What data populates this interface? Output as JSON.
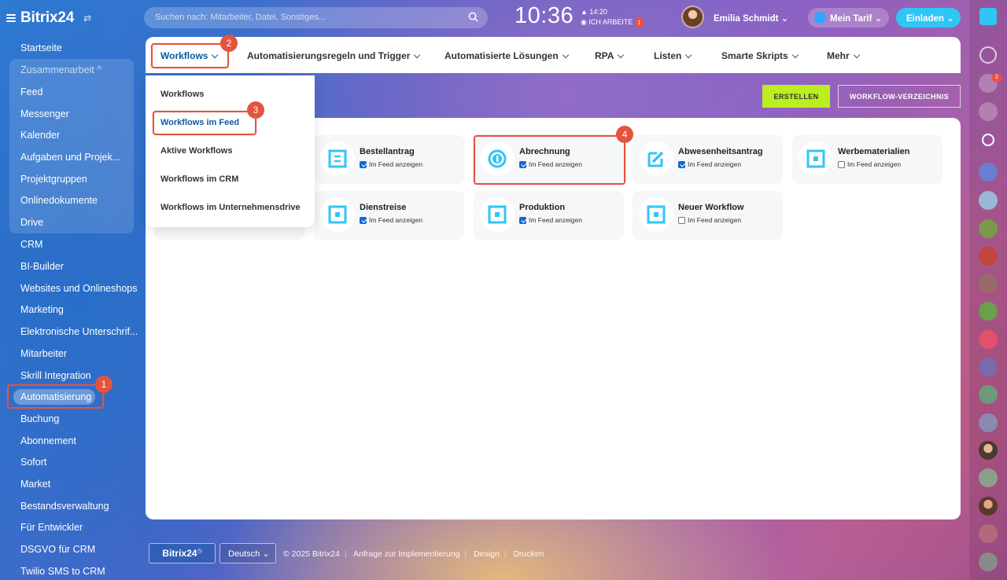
{
  "app": {
    "logo": "Bitrix24",
    "footer_logo": "Bitrix24"
  },
  "sidebar": {
    "items": [
      {
        "label": "Startseite"
      },
      {
        "label": "Zusammenarbeit ^"
      },
      {
        "label": "Feed"
      },
      {
        "label": "Messenger"
      },
      {
        "label": "Kalender"
      },
      {
        "label": "Aufgaben und Projek..."
      },
      {
        "label": "Projektgruppen"
      },
      {
        "label": "Onlinedokumente"
      },
      {
        "label": "Drive"
      },
      {
        "label": "CRM"
      },
      {
        "label": "BI-Builder"
      },
      {
        "label": "Websites und Onlineshops"
      },
      {
        "label": "Marketing"
      },
      {
        "label": "Elektronische Unterschrif..."
      },
      {
        "label": "Mitarbeiter"
      },
      {
        "label": "Skrill Integration"
      },
      {
        "label": "Automatisierung"
      },
      {
        "label": "Buchung"
      },
      {
        "label": "Abonnement"
      },
      {
        "label": "Sofort"
      },
      {
        "label": "Market"
      },
      {
        "label": "Bestandsverwaltung"
      },
      {
        "label": "Für Entwickler"
      },
      {
        "label": "DSGVO für CRM"
      },
      {
        "label": "Twilio SMS to CRM"
      }
    ]
  },
  "topbar": {
    "search_placeholder": "Suchen nach: Mitarbeiter, Datei, Sonstiges...",
    "clock": "10:36",
    "clock_sub_time": "▲ 14:20",
    "status": "ICH ARBEITE",
    "status_badge": "1",
    "user_name": "Emilia Schmidt ⌄",
    "tarif": "Mein Tarif ⌄",
    "invite": "Einladen ⌄"
  },
  "tabs": [
    {
      "label": "Workflows"
    },
    {
      "label": "Automatisierungsregeln und Trigger"
    },
    {
      "label": "Automatisierte Lösungen"
    },
    {
      "label": "RPA"
    },
    {
      "label": "Listen"
    },
    {
      "label": "Smarte Skripts"
    },
    {
      "label": "Mehr"
    }
  ],
  "dropdown": {
    "items": [
      {
        "label": "Workflows"
      },
      {
        "label": "Workflows im Feed"
      },
      {
        "label": "Aktive Workflows"
      },
      {
        "label": "Workflows im CRM"
      },
      {
        "label": "Workflows im Unternehmensdrive"
      }
    ]
  },
  "actions": {
    "create": "ERSTELLEN",
    "directory": "WORKFLOW-VERZEICHNIS"
  },
  "feed_label": "Im Feed anzeigen",
  "cards": [
    {
      "name": "Bestellantrag",
      "checked": true,
      "icon": "document-icon"
    },
    {
      "name": "Abrechnung",
      "checked": true,
      "icon": "coin-icon"
    },
    {
      "name": "Abwesenheitsantrag",
      "checked": true,
      "icon": "edit-icon"
    },
    {
      "name": "Werbematerialien",
      "checked": false,
      "icon": "square-icon"
    },
    {
      "name": "Dienstreise",
      "checked": true,
      "icon": "square-icon"
    },
    {
      "name": "Produktion",
      "checked": true,
      "icon": "square-icon"
    },
    {
      "name": "Neuer Workflow",
      "checked": false,
      "icon": "square-icon"
    }
  ],
  "callouts": [
    "1",
    "2",
    "3",
    "4"
  ],
  "rail_badge": "2",
  "footer": {
    "language": "Deutsch ⌄",
    "copyright": "© 2025 Bitrix24",
    "links": [
      "Anfrage zur Implementierung",
      "Design",
      "Drucken"
    ]
  },
  "colors": {
    "accent": "#2fc6f6",
    "create": "#bbed21",
    "callout": "#e2543f",
    "icon": "#2fc6f6",
    "link_active": "#0a5a9c"
  }
}
